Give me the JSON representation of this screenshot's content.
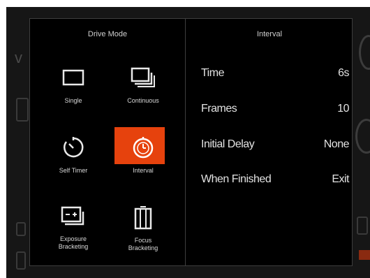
{
  "drive_mode": {
    "title": "Drive Mode",
    "modes": [
      {
        "label": "Single",
        "icon": "single-frame-icon",
        "selected": false
      },
      {
        "label": "Continuous",
        "icon": "continuous-frames-icon",
        "selected": false
      },
      {
        "label": "Self Timer",
        "icon": "self-timer-icon",
        "selected": false
      },
      {
        "label": "Interval",
        "icon": "interval-timer-icon",
        "selected": true
      },
      {
        "label": "Exposure\nBracketing",
        "icon": "exposure-bracketing-icon",
        "selected": false
      },
      {
        "label": "Focus\nBracketing",
        "icon": "focus-bracketing-icon",
        "selected": false
      }
    ]
  },
  "interval": {
    "title": "Interval",
    "settings": [
      {
        "label": "Time",
        "value": "6s"
      },
      {
        "label": "Frames",
        "value": "10"
      },
      {
        "label": "Initial Delay",
        "value": "None"
      },
      {
        "label": "When Finished",
        "value": "Exit"
      }
    ]
  },
  "colors": {
    "selected_accent": "#e6420d",
    "panel_background": "#000000",
    "text": "#e2e2e2"
  }
}
